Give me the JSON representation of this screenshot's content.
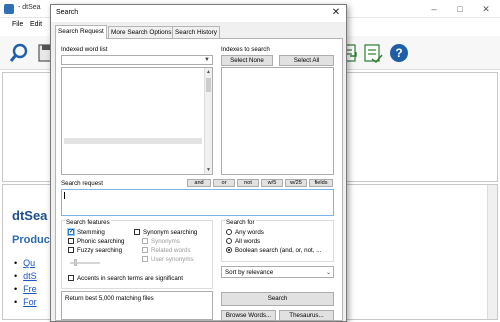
{
  "app": {
    "title": "- dtSea",
    "menu": [
      "File",
      "Edit"
    ],
    "window_controls": [
      "–",
      "□",
      "✕"
    ],
    "heading": "dtSea",
    "subheading": "Produc",
    "bullets": [
      "Qu",
      "dtS",
      "Fre",
      "For"
    ]
  },
  "dialog": {
    "title": "Search",
    "close": "✕",
    "tabs": [
      "Search Request",
      "More Search Options",
      "Search History"
    ],
    "indexed_word_list_label": "Indexed word list",
    "indexes_label": "Indexes to search",
    "select_none": "Select None",
    "select_all": "Select All",
    "search_request_label": "Search request",
    "operators": [
      "and",
      "or",
      "not",
      "w/5",
      "w/25",
      "fields"
    ],
    "search_request_value": "",
    "search_features": {
      "label": "Search features",
      "stemming": "Stemming",
      "phonic": "Phonic searching",
      "fuzzy": "Fuzzy searching",
      "synonym": "Synonym searching",
      "synonyms": "Synonyms",
      "related": "Related words",
      "user_synonyms": "User synonyms",
      "accents": "Accents in search terms are significant"
    },
    "search_for": {
      "label": "Search for",
      "any": "Any words",
      "all": "All words",
      "boolean": "Boolean search (and, or, not, ..."
    },
    "sort_value": "Sort by relevance",
    "result_text": "Return best 5,000 matching files",
    "search_button": "Search",
    "browse_button": "Browse Words...",
    "thesaurus_button": "Thesaurus..."
  },
  "colors": {
    "accent": "#1e7fd6",
    "brand_blue": "#2b6cb0",
    "help_icon": "#1f5fa8"
  },
  "icons": [
    "search-icon",
    "save-icon",
    "index-icon",
    "index-update-icon",
    "help-icon"
  ]
}
